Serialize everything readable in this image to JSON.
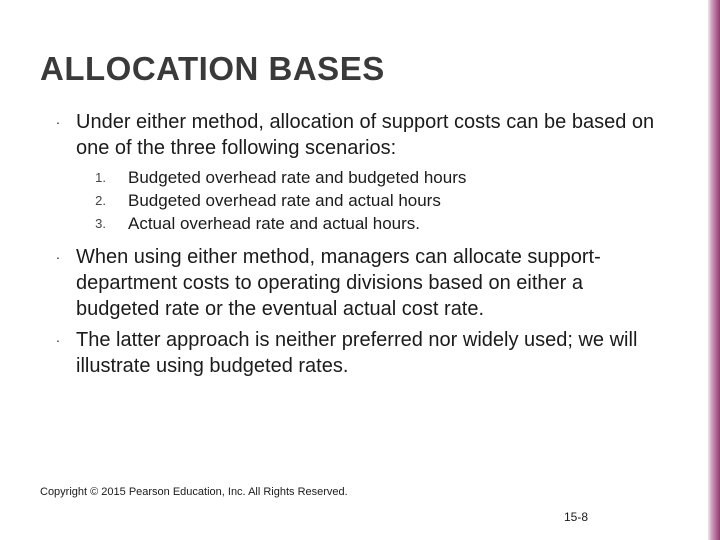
{
  "title": "ALLOCATION BASES",
  "bullets": {
    "b0": "Under either method, allocation of support costs can be based on one of the three following scenarios:",
    "b1": "When using either method, managers can allocate support-department costs to operating divisions based on either a budgeted rate or the eventual actual cost rate.",
    "b2": "The latter approach is neither preferred nor widely used; we will illustrate using budgeted rates."
  },
  "numbered": {
    "n1_marker": "1.",
    "n1": "Budgeted overhead rate and budgeted hours",
    "n2_marker": "2.",
    "n2": "Budgeted overhead rate and actual hours",
    "n3_marker": "3.",
    "n3": "Actual overhead rate and actual hours."
  },
  "dot": "·",
  "copyright": "Copyright © 2015 Pearson Education, Inc. All Rights Reserved.",
  "slidenum": "15-8"
}
